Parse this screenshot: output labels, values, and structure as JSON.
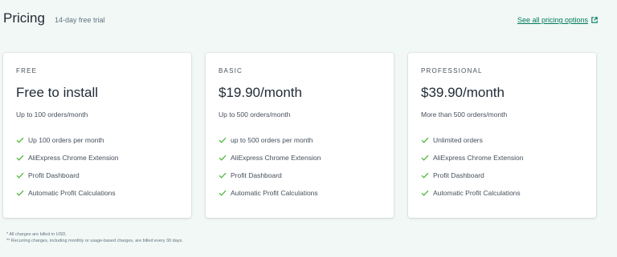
{
  "header": {
    "title": "Pricing",
    "subtitle": "14-day free trial",
    "see_all_link": "See all pricing options",
    "link_icon": "external-link-icon"
  },
  "colors": {
    "background": "#f1f8f5",
    "accent": "#50b83c",
    "link": "#007a5c"
  },
  "plans": [
    {
      "label": "FREE",
      "price": "Free to install",
      "limit": "Up to 100 orders/month",
      "features": [
        "Up 100 orders per month",
        "AliExpress Chrome Extension",
        "Profit Dashboard",
        "Automatic Profit Calculations"
      ]
    },
    {
      "label": "BASIC",
      "price": "$19.90/month",
      "limit": "Up to 500 orders/month",
      "features": [
        "up to 500 orders per month",
        "AliExpress Chrome Extension",
        "Profit Dashboard",
        "Automatic Profit Calculations"
      ]
    },
    {
      "label": "PROFESSIONAL",
      "price": "$39.90/month",
      "limit": "More than 500 orders/month",
      "features": [
        "Unlimited orders",
        "AliExpress Chrome Extension",
        "Profit Dashboard",
        "Automatic Profit Calculations"
      ]
    }
  ],
  "feature_icon": "checkmark-icon",
  "footnotes": [
    "* All charges are billed in USD.",
    "** Recurring charges, including monthly or usage-based charges, are billed every 30 days."
  ]
}
